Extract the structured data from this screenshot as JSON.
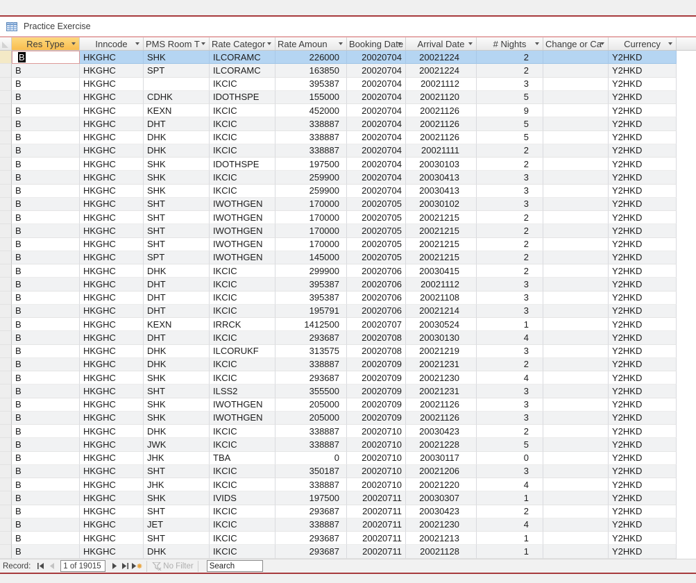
{
  "tab": {
    "title": "Practice Exercise"
  },
  "columns": [
    {
      "id": "res-type",
      "label": "Res Type",
      "truncated": false
    },
    {
      "id": "inncode",
      "label": "Inncode",
      "truncated": false
    },
    {
      "id": "pms-room-type",
      "label": "PMS Room T",
      "truncated": true
    },
    {
      "id": "rate-category",
      "label": "Rate Categor",
      "truncated": true
    },
    {
      "id": "rate-amount",
      "label": "Rate Amoun",
      "truncated": true
    },
    {
      "id": "booking-date",
      "label": "Booking Date",
      "truncated": true
    },
    {
      "id": "arrival-date",
      "label": "Arrival Date",
      "truncated": false
    },
    {
      "id": "num-nights",
      "label": "# Nights",
      "truncated": false
    },
    {
      "id": "change-or-cancel",
      "label": "Change or Ca",
      "truncated": true
    },
    {
      "id": "currency",
      "label": "Currency",
      "truncated": false
    }
  ],
  "rows": [
    [
      "B",
      "HKGHC",
      "SHK",
      "ILCORAMC",
      "226000",
      "20020704",
      "20021224",
      "2",
      "",
      "Y2HKD"
    ],
    [
      "B",
      "HKGHC",
      "SPT",
      "ILCORAMC",
      "163850",
      "20020704",
      "20021224",
      "2",
      "",
      "Y2HKD"
    ],
    [
      "B",
      "HKGHC",
      "",
      "IKCIC",
      "395387",
      "20020704",
      "20021112",
      "3",
      "",
      "Y2HKD"
    ],
    [
      "B",
      "HKGHC",
      "CDHK",
      "IDOTHSPE",
      "155000",
      "20020704",
      "20021120",
      "5",
      "",
      "Y2HKD"
    ],
    [
      "B",
      "HKGHC",
      "KEXN",
      "IKCIC",
      "452000",
      "20020704",
      "20021126",
      "9",
      "",
      "Y2HKD"
    ],
    [
      "B",
      "HKGHC",
      "DHT",
      "IKCIC",
      "338887",
      "20020704",
      "20021126",
      "5",
      "",
      "Y2HKD"
    ],
    [
      "B",
      "HKGHC",
      "DHK",
      "IKCIC",
      "338887",
      "20020704",
      "20021126",
      "5",
      "",
      "Y2HKD"
    ],
    [
      "B",
      "HKGHC",
      "DHK",
      "IKCIC",
      "338887",
      "20020704",
      "20021111",
      "2",
      "",
      "Y2HKD"
    ],
    [
      "B",
      "HKGHC",
      "SHK",
      "IDOTHSPE",
      "197500",
      "20020704",
      "20030103",
      "2",
      "",
      "Y2HKD"
    ],
    [
      "B",
      "HKGHC",
      "SHK",
      "IKCIC",
      "259900",
      "20020704",
      "20030413",
      "3",
      "",
      "Y2HKD"
    ],
    [
      "B",
      "HKGHC",
      "SHK",
      "IKCIC",
      "259900",
      "20020704",
      "20030413",
      "3",
      "",
      "Y2HKD"
    ],
    [
      "B",
      "HKGHC",
      "SHT",
      "IWOTHGEN",
      "170000",
      "20020705",
      "20030102",
      "3",
      "",
      "Y2HKD"
    ],
    [
      "B",
      "HKGHC",
      "SHT",
      "IWOTHGEN",
      "170000",
      "20020705",
      "20021215",
      "2",
      "",
      "Y2HKD"
    ],
    [
      "B",
      "HKGHC",
      "SHT",
      "IWOTHGEN",
      "170000",
      "20020705",
      "20021215",
      "2",
      "",
      "Y2HKD"
    ],
    [
      "B",
      "HKGHC",
      "SHT",
      "IWOTHGEN",
      "170000",
      "20020705",
      "20021215",
      "2",
      "",
      "Y2HKD"
    ],
    [
      "B",
      "HKGHC",
      "SPT",
      "IWOTHGEN",
      "145000",
      "20020705",
      "20021215",
      "2",
      "",
      "Y2HKD"
    ],
    [
      "B",
      "HKGHC",
      "DHK",
      "IKCIC",
      "299900",
      "20020706",
      "20030415",
      "2",
      "",
      "Y2HKD"
    ],
    [
      "B",
      "HKGHC",
      "DHT",
      "IKCIC",
      "395387",
      "20020706",
      "20021112",
      "3",
      "",
      "Y2HKD"
    ],
    [
      "B",
      "HKGHC",
      "DHT",
      "IKCIC",
      "395387",
      "20020706",
      "20021108",
      "3",
      "",
      "Y2HKD"
    ],
    [
      "B",
      "HKGHC",
      "DHT",
      "IKCIC",
      "195791",
      "20020706",
      "20021214",
      "3",
      "",
      "Y2HKD"
    ],
    [
      "B",
      "HKGHC",
      "KEXN",
      "IRRCK",
      "1412500",
      "20020707",
      "20030524",
      "1",
      "",
      "Y2HKD"
    ],
    [
      "B",
      "HKGHC",
      "DHT",
      "IKCIC",
      "293687",
      "20020708",
      "20030130",
      "4",
      "",
      "Y2HKD"
    ],
    [
      "B",
      "HKGHC",
      "DHK",
      "ILCORUKF",
      "313575",
      "20020708",
      "20021219",
      "3",
      "",
      "Y2HKD"
    ],
    [
      "B",
      "HKGHC",
      "DHK",
      "IKCIC",
      "338887",
      "20020709",
      "20021231",
      "2",
      "",
      "Y2HKD"
    ],
    [
      "B",
      "HKGHC",
      "SHK",
      "IKCIC",
      "293687",
      "20020709",
      "20021230",
      "4",
      "",
      "Y2HKD"
    ],
    [
      "B",
      "HKGHC",
      "SHT",
      "ILSS2",
      "355500",
      "20020709",
      "20021231",
      "3",
      "",
      "Y2HKD"
    ],
    [
      "B",
      "HKGHC",
      "SHK",
      "IWOTHGEN",
      "205000",
      "20020709",
      "20021126",
      "3",
      "",
      "Y2HKD"
    ],
    [
      "B",
      "HKGHC",
      "SHK",
      "IWOTHGEN",
      "205000",
      "20020709",
      "20021126",
      "3",
      "",
      "Y2HKD"
    ],
    [
      "B",
      "HKGHC",
      "DHK",
      "IKCIC",
      "338887",
      "20020710",
      "20030423",
      "2",
      "",
      "Y2HKD"
    ],
    [
      "B",
      "HKGHC",
      "JWK",
      "IKCIC",
      "338887",
      "20020710",
      "20021228",
      "5",
      "",
      "Y2HKD"
    ],
    [
      "B",
      "HKGHC",
      "JHK",
      "TBA",
      "0",
      "20020710",
      "20030117",
      "0",
      "",
      "Y2HKD"
    ],
    [
      "B",
      "HKGHC",
      "SHT",
      "IKCIC",
      "350187",
      "20020710",
      "20021206",
      "3",
      "",
      "Y2HKD"
    ],
    [
      "B",
      "HKGHC",
      "JHK",
      "IKCIC",
      "338887",
      "20020710",
      "20021220",
      "4",
      "",
      "Y2HKD"
    ],
    [
      "B",
      "HKGHC",
      "SHK",
      "IVIDS",
      "197500",
      "20020711",
      "20030307",
      "1",
      "",
      "Y2HKD"
    ],
    [
      "B",
      "HKGHC",
      "SHT",
      "IKCIC",
      "293687",
      "20020711",
      "20030423",
      "2",
      "",
      "Y2HKD"
    ],
    [
      "B",
      "HKGHC",
      "JET",
      "IKCIC",
      "338887",
      "20020711",
      "20021230",
      "4",
      "",
      "Y2HKD"
    ],
    [
      "B",
      "HKGHC",
      "SHT",
      "IKCIC",
      "293687",
      "20020711",
      "20021213",
      "1",
      "",
      "Y2HKD"
    ],
    [
      "B",
      "HKGHC",
      "DHK",
      "IKCIC",
      "293687",
      "20020711",
      "20021128",
      "1",
      "",
      "Y2HKD"
    ]
  ],
  "selection": {
    "row_index": 0,
    "col_index": 0,
    "editing_value": "B"
  },
  "record_nav": {
    "label": "Record:",
    "position": "1 of 19015",
    "filter_status": "No Filter",
    "search_placeholder": "Search"
  },
  "colors": {
    "accent_red": "#a73a3d",
    "header_selected": "#f9bd4e",
    "row_selected": "#b5d5f2"
  }
}
